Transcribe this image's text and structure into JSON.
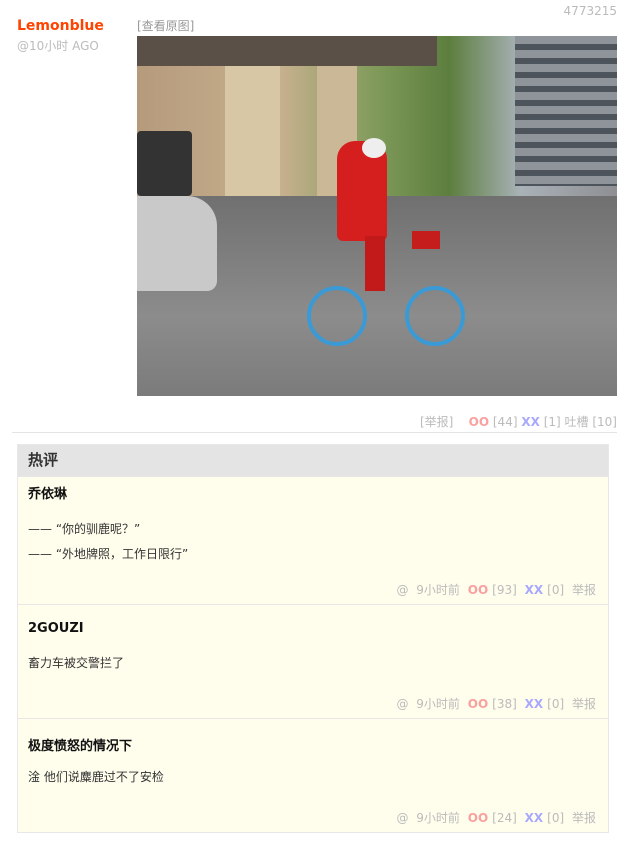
{
  "post": {
    "id": "4773215",
    "author": "Lemonblue",
    "time": "@10小时 AGO",
    "view_original": "[查看原图]",
    "report": "[举报]",
    "oo_label": "OO",
    "oo_count": "[44]",
    "xx_label": "XX",
    "xx_count": "[1]",
    "tucao_label": "吐槽",
    "tucao_count": "[10]"
  },
  "hot": {
    "title": "热评",
    "comments": [
      {
        "author": "乔依琳",
        "lines": [
          "—— “你的驯鹿呢？”",
          "—— “外地牌照，工作日限行”"
        ],
        "at": "@",
        "time": "9小时前",
        "oo": "OO",
        "oo_count": "[93]",
        "xx": "XX",
        "xx_count": "[0]",
        "report": "举报"
      },
      {
        "author": "2GOUZI",
        "lines": [
          "畜力车被交警拦了"
        ],
        "at": "@",
        "time": "9小时前",
        "oo": "OO",
        "oo_count": "[38]",
        "xx": "XX",
        "xx_count": "[0]",
        "report": "举报"
      },
      {
        "author": "极度愤怒的情况下",
        "lines": [
          "淦 他们说麋鹿过不了安检"
        ],
        "at": "@",
        "time": "9小时前",
        "oo": "OO",
        "oo_count": "[24]",
        "xx": "XX",
        "xx_count": "[0]",
        "report": "举报"
      }
    ]
  },
  "colors": {
    "author": "#ff4400",
    "oo": "#f9a0a0",
    "xx": "#a8a8ff",
    "comment_bg": "#fffeed"
  }
}
